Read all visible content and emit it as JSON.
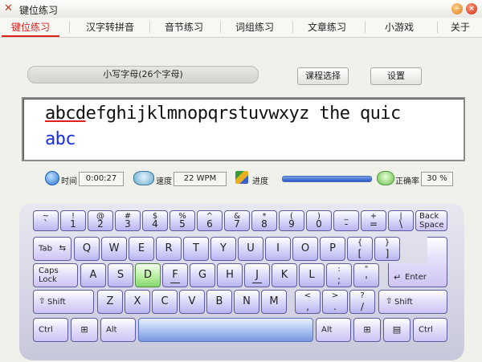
{
  "window": {
    "title": "键位练习",
    "app_icon": "x-logo-icon"
  },
  "menu": {
    "items": [
      {
        "label": "键位练习",
        "active": true
      },
      {
        "label": "汉字转拼音"
      },
      {
        "label": "音节练习"
      },
      {
        "label": "词组练习"
      },
      {
        "label": "文章练习"
      },
      {
        "label": "小游戏"
      },
      {
        "label": "关于"
      }
    ]
  },
  "lesson": {
    "current": "小写字母(26个字母)",
    "select_label": "课程选择",
    "settings_label": "设置"
  },
  "practice": {
    "target_typed": "abcd",
    "target_rest": "efghijklmnopqrstuvwxyz the quic",
    "input_text": "abc"
  },
  "stats": {
    "time_label": "时间",
    "time_value": "0:00:27",
    "speed_label": "速度",
    "speed_value": "22 WPM",
    "progress_label": "进度",
    "progress_fraction": 1.0,
    "accuracy_label": "正确率",
    "accuracy_value": "30 %"
  },
  "keyboard": {
    "row1": [
      {
        "sup": "~",
        "sub": "`"
      },
      {
        "sup": "!",
        "sub": "1"
      },
      {
        "sup": "@",
        "sub": "2"
      },
      {
        "sup": "#",
        "sub": "3"
      },
      {
        "sup": "$",
        "sub": "4"
      },
      {
        "sup": "%",
        "sub": "5"
      },
      {
        "sup": "^",
        "sub": "6"
      },
      {
        "sup": "&",
        "sub": "7"
      },
      {
        "sup": "*",
        "sub": "8"
      },
      {
        "sup": "(",
        "sub": "9"
      },
      {
        "sup": ")",
        "sub": "0"
      },
      {
        "sup": "_",
        "sub": "-"
      },
      {
        "sup": "+",
        "sub": "="
      },
      {
        "sup": "|",
        "sub": "\\"
      }
    ],
    "backspace": "Back Space",
    "tab": "Tab",
    "row2": [
      "Q",
      "W",
      "E",
      "R",
      "T",
      "Y",
      "U",
      "I",
      "O",
      "P"
    ],
    "row2_brackets": [
      {
        "sup": "{",
        "sub": "["
      },
      {
        "sup": "}",
        "sub": "]"
      }
    ],
    "caps": "Caps Lock",
    "row3": [
      "A",
      "S",
      "D",
      "F",
      "G",
      "H",
      "J",
      "K",
      "L"
    ],
    "row3_punct": [
      {
        "sup": ":",
        "sub": ";"
      },
      {
        "sup": "\"",
        "sub": "'"
      }
    ],
    "enter": "Enter",
    "shift": "Shift",
    "row4": [
      "Z",
      "X",
      "C",
      "V",
      "B",
      "N",
      "M"
    ],
    "row4_punct": [
      {
        "sup": "<",
        "sub": ","
      },
      {
        "sup": ">",
        "sub": "."
      },
      {
        "sup": "?",
        "sub": "/"
      }
    ],
    "ctrl": "Ctrl",
    "alt": "Alt",
    "highlighted_key": "D"
  }
}
